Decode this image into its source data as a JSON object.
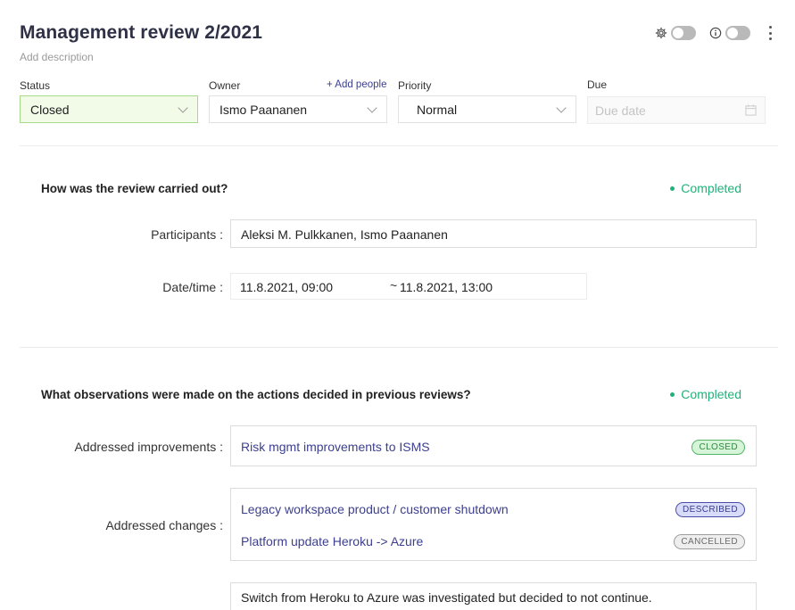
{
  "header": {
    "title": "Management review 2/2021",
    "add_description": "Add description"
  },
  "fields": {
    "status": {
      "label": "Status",
      "value": "Closed"
    },
    "owner": {
      "label": "Owner",
      "value": "Ismo Paananen",
      "add_people": "+ Add people"
    },
    "priority": {
      "label": "Priority",
      "value": "Normal"
    },
    "due": {
      "label": "Due",
      "placeholder": "Due date"
    }
  },
  "section1": {
    "title": "How was the review carried out?",
    "status": "Completed",
    "participants_label": "Participants :",
    "participants_value": "Aleksi M. Pulkkanen, Ismo Paananen",
    "datetime_label": "Date/time :",
    "start": "11.8.2021, 09:00",
    "separator": "~",
    "end": "11.8.2021, 13:00"
  },
  "section2": {
    "title": "What observations were made on the actions decided in previous reviews?",
    "status": "Completed",
    "improvements_label": "Addressed improvements :",
    "improvements": [
      {
        "text": "Risk mgmt improvements to ISMS",
        "badge": "CLOSED"
      }
    ],
    "changes_label": "Addressed changes :",
    "changes": [
      {
        "text": "Legacy workspace product / customer shutdown",
        "badge": "DESCRIBED"
      },
      {
        "text": "Platform update Heroku -> Azure",
        "badge": "CANCELLED"
      }
    ],
    "note": "Switch from Heroku to Azure was investigated but decided to not continue."
  },
  "colors": {
    "accent": "#3c3f8f",
    "completed": "#1fb27a",
    "status_bg": "#f1fbe8",
    "status_border": "#a6d98a"
  },
  "icons": [
    "gear-icon",
    "info-icon",
    "kebab-menu-icon",
    "calendar-icon",
    "chevron-down-icon"
  ]
}
